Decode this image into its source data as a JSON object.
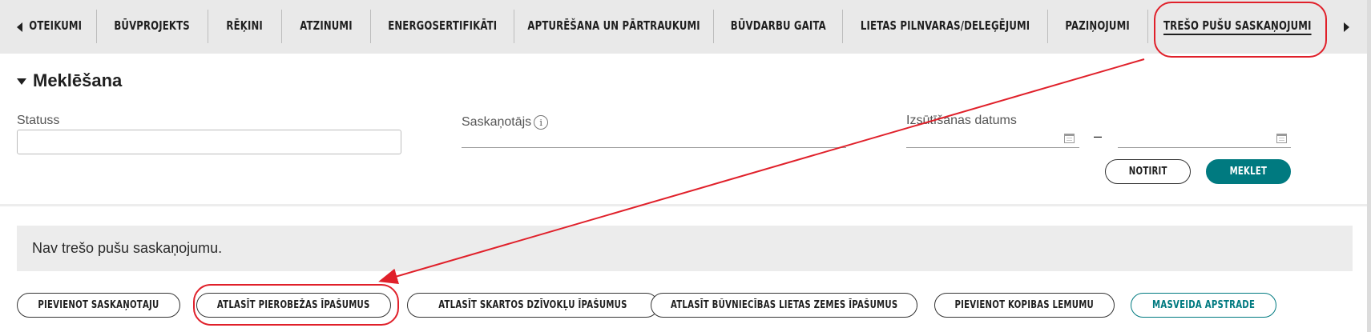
{
  "tabs": [
    {
      "label": "OTEIKUMI"
    },
    {
      "label": "BŪVPROJEKTS"
    },
    {
      "label": "RĒĶINI"
    },
    {
      "label": "ATZINUMI"
    },
    {
      "label": "ENERGOSERTIFIKĀTI"
    },
    {
      "label": "APTURĒŠANA UN PĀRTRAUKUMI"
    },
    {
      "label": "BŪVDARBU GAITA"
    },
    {
      "label": "LIETAS PILNVARAS/DELEĢĒJUMI"
    },
    {
      "label": "PAZIŅOJUMI"
    },
    {
      "label": "TREŠO PUŠU SASKAŅOJUMI"
    }
  ],
  "active_tab": "TREŠO PUŠU SASKAŅOJUMI",
  "search": {
    "title": "Meklēšana",
    "status_label": "Statuss",
    "status_value": "",
    "approver_label": "Saskaņotājs",
    "approver_value": "",
    "date_label": "Izsūtīšanas datums",
    "date_from": "",
    "date_to": "",
    "date_separator": "–",
    "clear_label": "NOTĪRĪT",
    "search_label": "MEKLĒT"
  },
  "results": {
    "empty_message": "Nav trešo pušu saskaņojumu."
  },
  "actions": {
    "add_approver": "PIEVIENOT SASKAŅOTĀJU",
    "select_adjacent": "ATLASĪT PIEROBEŽAS ĪPAŠUMUS",
    "select_apartment": "ATLASĪT SKARTOS DZĪVOKĻU ĪPAŠUMUS",
    "select_land": "ATLASĪT BŪVNIECĪBAS LIETAS ZEMES ĪPAŠUMUS",
    "add_joint_decision": "PIEVIENOT KOPĪBAS LĒMUMU",
    "bulk_processing": "MASVEIDA APSTRĀDE"
  },
  "colors": {
    "accent": "#007a80",
    "annotation": "#e0202a",
    "tab_bar": "#e9e9e9"
  },
  "icons": {
    "scroll_left": "triangle-left",
    "scroll_right": "triangle-right",
    "section_toggle": "triangle-down",
    "info": "info-circle",
    "calendar": "calendar"
  }
}
